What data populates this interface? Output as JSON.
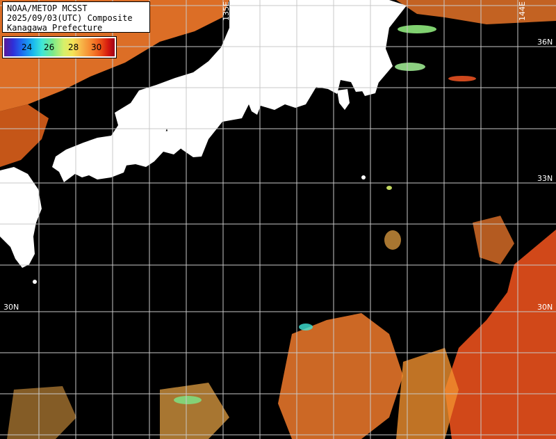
{
  "title": {
    "line1": "NOAA/METOP MCSST",
    "line2": "2025/09/03(UTC) Composite",
    "line3": "Kanagawa Prefecture"
  },
  "legend": {
    "ticks": [
      "24",
      "26",
      "28",
      "30"
    ],
    "gradient_colors": [
      "#5a1a96",
      "#2f2fd8",
      "#19b8ef",
      "#7be98a",
      "#f4e357",
      "#f57f2c",
      "#d51a0f",
      "#a0001a"
    ]
  },
  "grid": {
    "lon_labels": [
      "135E",
      "144E"
    ],
    "lat_labels_right": [
      "36N",
      "33N",
      "30N"
    ],
    "lat_labels_left": [
      "30N"
    ]
  },
  "colors": {
    "land": "#ffffff",
    "background": "#000000",
    "grid": "#c8c8c8"
  }
}
